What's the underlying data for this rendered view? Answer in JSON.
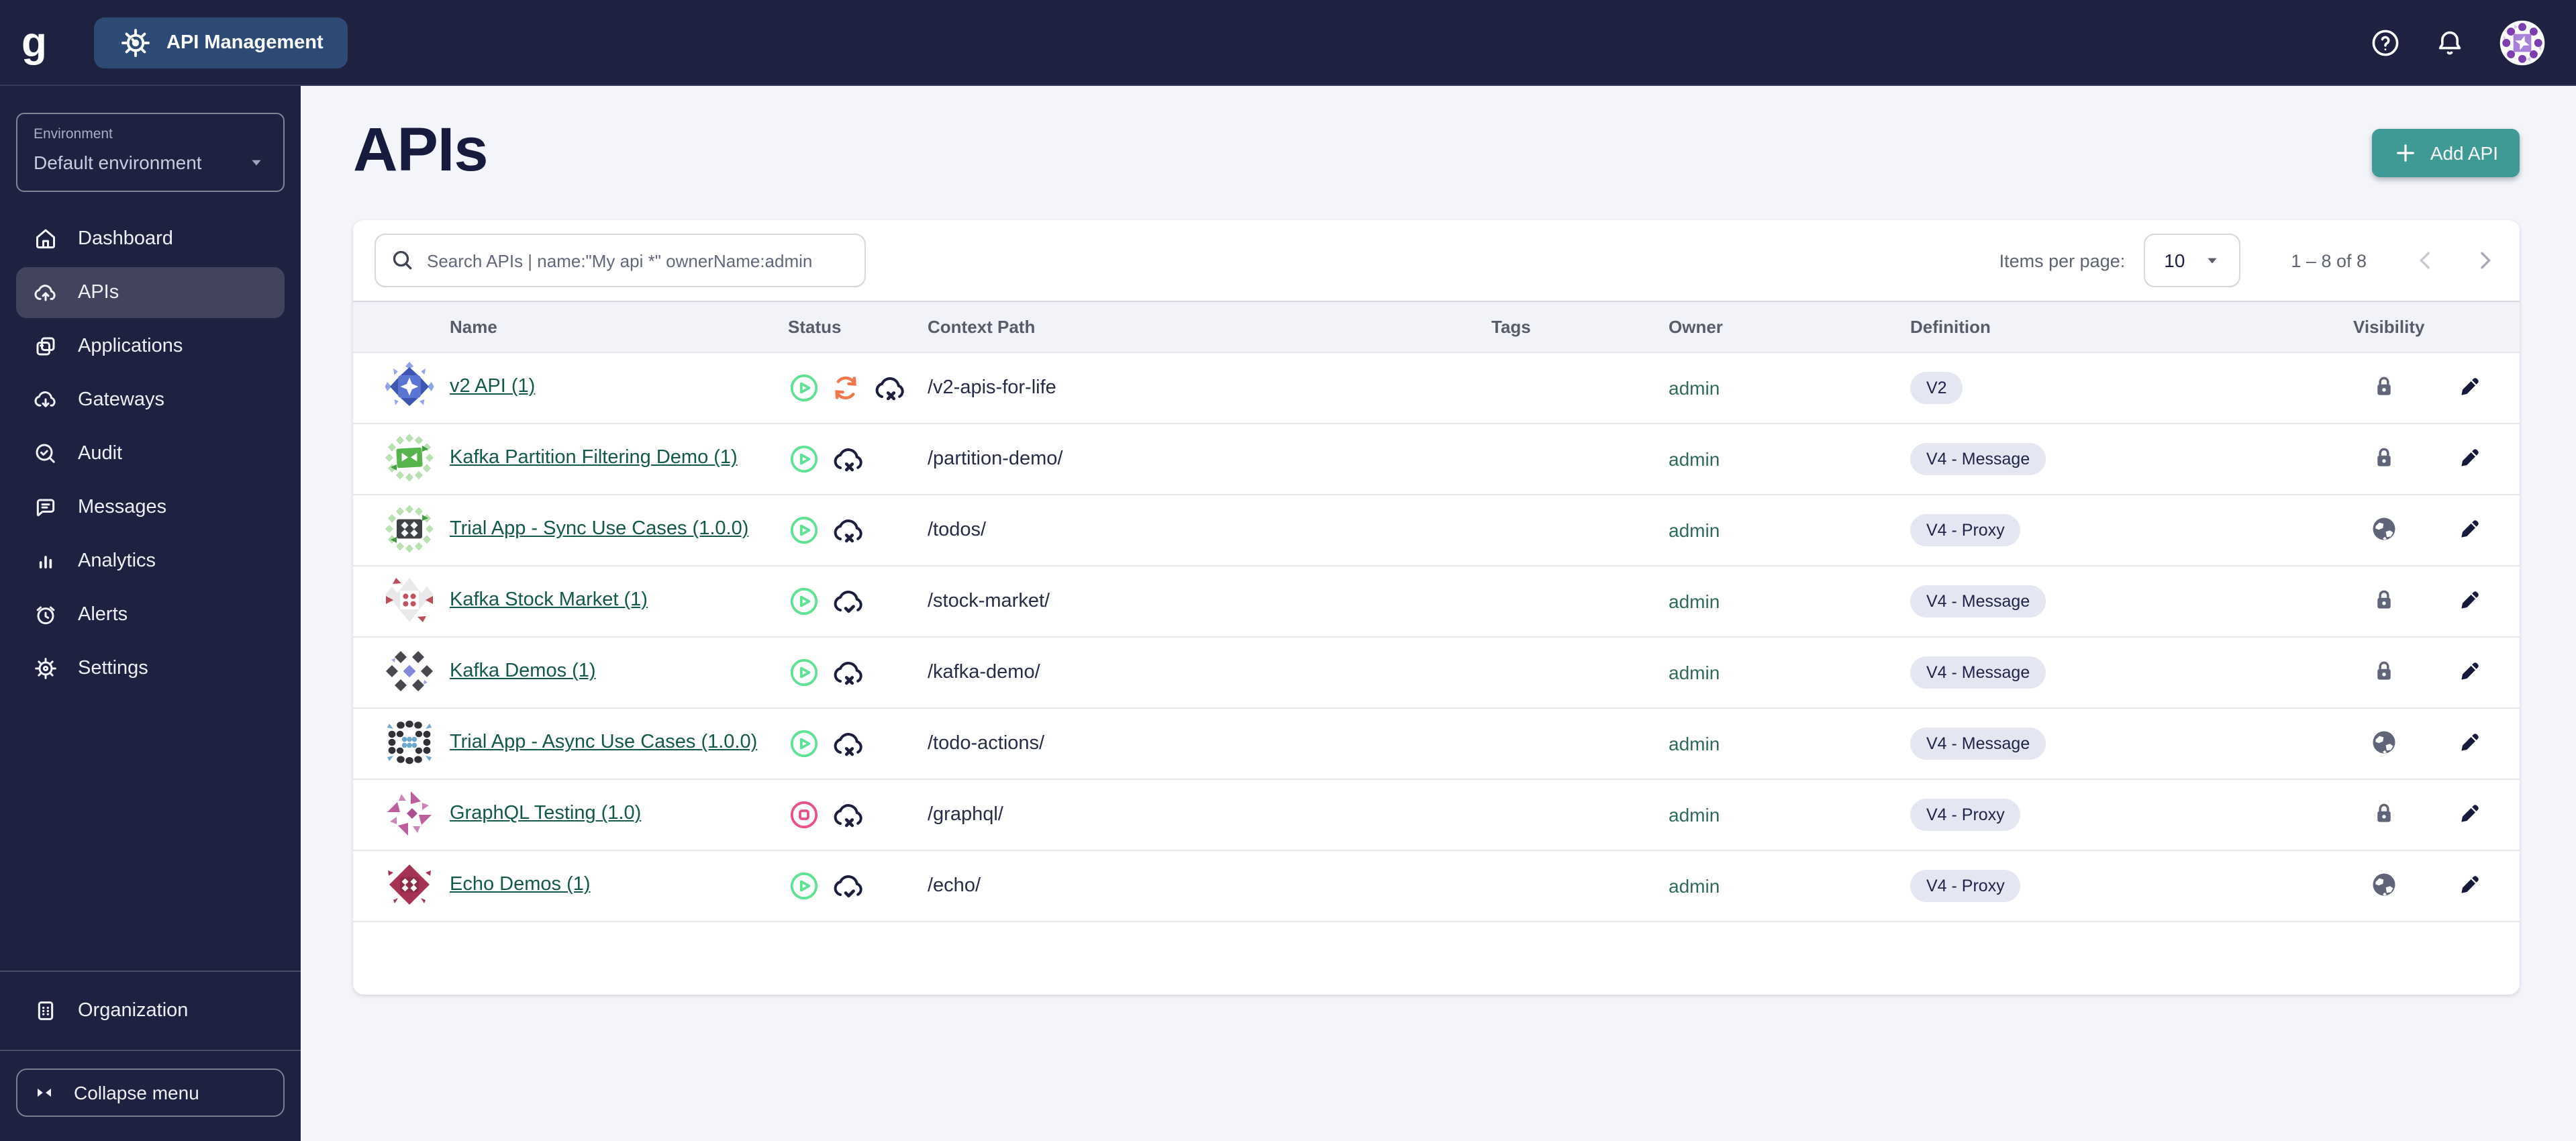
{
  "topbar": {
    "logo_letter": "g",
    "product_label": "API Management",
    "icons": [
      "help-icon",
      "notifications-bell-icon",
      "user-avatar"
    ]
  },
  "sidebar": {
    "environment": {
      "label": "Environment",
      "value": "Default environment"
    },
    "items": [
      {
        "label": "Dashboard",
        "icon": "home",
        "active": false
      },
      {
        "label": "APIs",
        "icon": "cloud-up",
        "active": true
      },
      {
        "label": "Applications",
        "icon": "apps",
        "active": false
      },
      {
        "label": "Gateways",
        "icon": "cloud-down",
        "active": false
      },
      {
        "label": "Audit",
        "icon": "audit",
        "active": false
      },
      {
        "label": "Messages",
        "icon": "message",
        "active": false
      },
      {
        "label": "Analytics",
        "icon": "analytics",
        "active": false
      },
      {
        "label": "Alerts",
        "icon": "alarm",
        "active": false
      },
      {
        "label": "Settings",
        "icon": "gear",
        "active": false
      }
    ],
    "secondary_items": [
      {
        "label": "Organization",
        "icon": "org"
      }
    ],
    "collapse": {
      "label": "Collapse menu",
      "icon": "collapse"
    }
  },
  "page": {
    "title": "APIs",
    "add_api_label": "Add API"
  },
  "toolbar": {
    "search_placeholder": "Search APIs | name:\"My api *\" ownerName:admin",
    "items_per_page_label": "Items per page:",
    "items_per_page_value": "10",
    "range_text": "1 – 8 of 8"
  },
  "table": {
    "columns": {
      "name": "Name",
      "status": "Status",
      "context_path": "Context Path",
      "tags": "Tags",
      "owner": "Owner",
      "definition": "Definition",
      "visibility": "Visibility"
    },
    "rows": [
      {
        "name": "v2 API (1)",
        "avatar": "blue-star",
        "status": [
          "play",
          "sync",
          "cloud-x"
        ],
        "context_path": "/v2-apis-for-life",
        "tags": "",
        "owner": "admin",
        "definition": "V2",
        "visibility": "lock"
      },
      {
        "name": "Kafka Partition Filtering Demo (1)",
        "avatar": "green-arrows",
        "status": [
          "play",
          "cloud-x"
        ],
        "context_path": "/partition-demo/",
        "tags": "",
        "owner": "admin",
        "definition": "V4 - Message",
        "visibility": "lock"
      },
      {
        "name": "Trial App - Sync Use Cases (1.0.0)",
        "avatar": "green-domino",
        "status": [
          "play",
          "cloud-x"
        ],
        "context_path": "/todos/",
        "tags": "",
        "owner": "admin",
        "definition": "V4 - Proxy",
        "visibility": "globe"
      },
      {
        "name": "Kafka Stock Market (1)",
        "avatar": "gray-red-dots",
        "status": [
          "play",
          "cloud-check"
        ],
        "context_path": "/stock-market/",
        "tags": "",
        "owner": "admin",
        "definition": "V4 - Message",
        "visibility": "lock"
      },
      {
        "name": "Kafka Demos (1)",
        "avatar": "dark-diamonds",
        "status": [
          "play",
          "cloud-x"
        ],
        "context_path": "/kafka-demo/",
        "tags": "",
        "owner": "admin",
        "definition": "V4 - Message",
        "visibility": "lock"
      },
      {
        "name": "Trial App - Async Use Cases (1.0.0)",
        "avatar": "dots-blue",
        "status": [
          "play",
          "cloud-x"
        ],
        "context_path": "/todo-actions/",
        "tags": "",
        "owner": "admin",
        "definition": "V4 - Message",
        "visibility": "globe"
      },
      {
        "name": "GraphQL Testing (1.0)",
        "avatar": "pink-pinwheel",
        "status": [
          "stop",
          "cloud-x"
        ],
        "context_path": "/graphql/",
        "tags": "",
        "owner": "admin",
        "definition": "V4 - Proxy",
        "visibility": "lock"
      },
      {
        "name": "Echo Demos (1)",
        "avatar": "crimson-echo",
        "status": [
          "play",
          "cloud-check"
        ],
        "context_path": "/echo/",
        "tags": "",
        "owner": "admin",
        "definition": "V4 - Proxy",
        "visibility": "globe"
      }
    ]
  },
  "colors": {
    "topbar_bg": "#1e2140",
    "chip_bg": "#2c4a73",
    "accent_teal": "#3f9a96",
    "status_started": "#5fe294",
    "status_stopped": "#e8508c",
    "status_out_of_sync": "#f1764e",
    "link_green": "#14584c",
    "pill_bg": "#e4e6f1",
    "main_bg": "#f4f5fa"
  }
}
